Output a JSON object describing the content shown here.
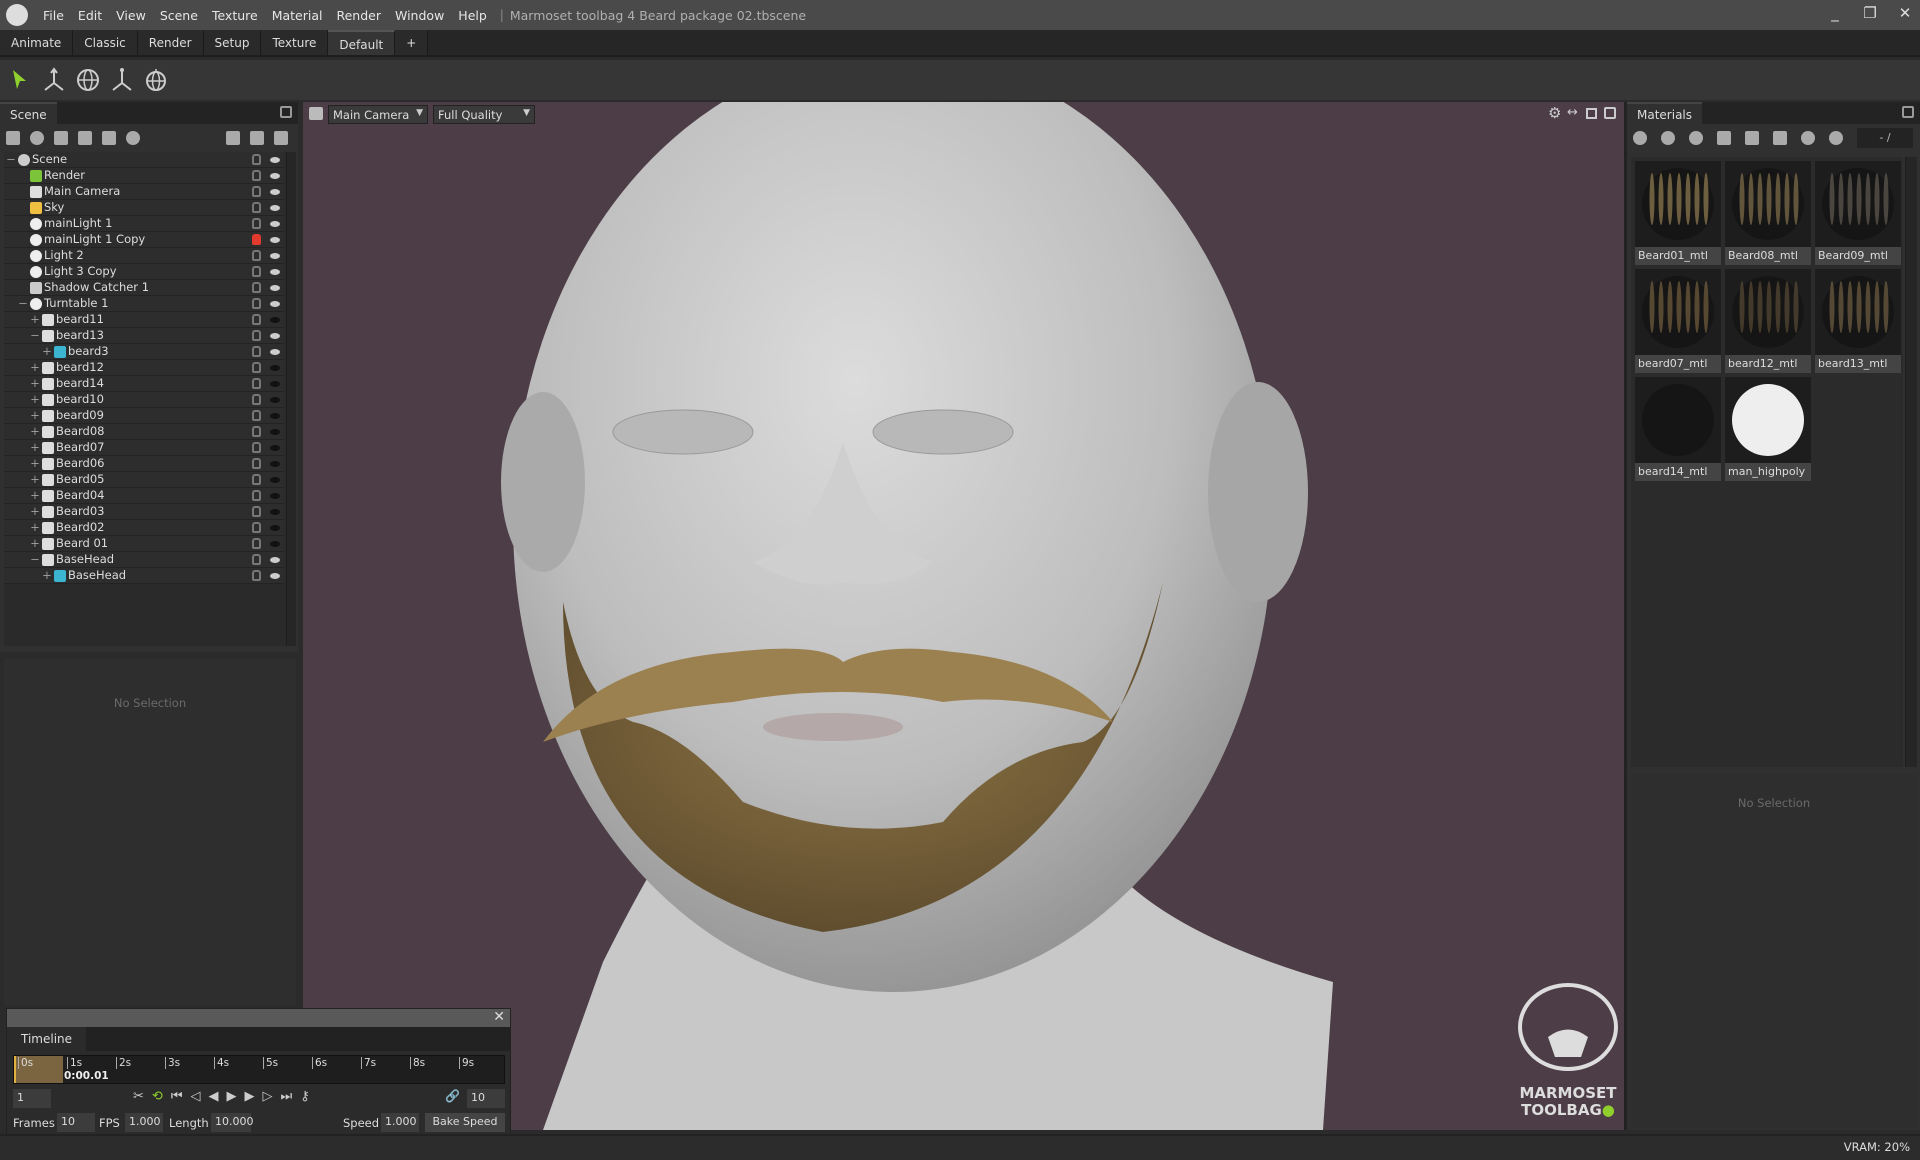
{
  "titlebar": {
    "menus": [
      "File",
      "Edit",
      "View",
      "Scene",
      "Texture",
      "Material",
      "Render",
      "Window",
      "Help"
    ],
    "title": "Marmoset toolbag 4 Beard package 02.tbscene"
  },
  "layout_tabs": [
    "Animate",
    "Classic",
    "Render",
    "Setup",
    "Texture",
    "Default",
    "+"
  ],
  "active_layout": "Default",
  "tools": [
    "select-arrow-icon",
    "move-gizmo-icon",
    "rotate-gizmo-icon",
    "scale-gizmo-icon",
    "turntable-gizmo-icon"
  ],
  "scene": {
    "tab": "Scene",
    "no_selection": "No Selection",
    "tree": [
      {
        "label": "Scene",
        "level": 0,
        "exp": "−",
        "icon": "scene",
        "eye": "open",
        "lock": "off"
      },
      {
        "label": "Render",
        "level": 1,
        "exp": "",
        "icon": "render",
        "eye": "open",
        "lock": "off"
      },
      {
        "label": "Main Camera",
        "level": 1,
        "exp": "",
        "icon": "camera",
        "eye": "open",
        "lock": "off"
      },
      {
        "label": "Sky",
        "level": 1,
        "exp": "",
        "icon": "sky",
        "eye": "open",
        "lock": "off"
      },
      {
        "label": "mainLight 1",
        "level": 1,
        "exp": "",
        "icon": "light",
        "eye": "open",
        "lock": "off"
      },
      {
        "label": "mainLight 1 Copy",
        "level": 1,
        "exp": "",
        "icon": "light",
        "eye": "open",
        "lock": "on"
      },
      {
        "label": "Light 2",
        "level": 1,
        "exp": "",
        "icon": "light",
        "eye": "open",
        "lock": "off"
      },
      {
        "label": "Light 3 Copy",
        "level": 1,
        "exp": "",
        "icon": "light",
        "eye": "open",
        "lock": "off"
      },
      {
        "label": "Shadow Catcher 1",
        "level": 1,
        "exp": "",
        "icon": "shadow",
        "eye": "open",
        "lock": "off"
      },
      {
        "label": "Turntable 1",
        "level": 1,
        "exp": "−",
        "icon": "turntable",
        "eye": "open",
        "lock": "off"
      },
      {
        "label": "beard11",
        "level": 2,
        "exp": "+",
        "icon": "group",
        "eye": "dark",
        "lock": "off"
      },
      {
        "label": "beard13",
        "level": 2,
        "exp": "−",
        "icon": "group",
        "eye": "open",
        "lock": "off"
      },
      {
        "label": "beard3",
        "level": 3,
        "exp": "+",
        "icon": "mesh",
        "eye": "open",
        "lock": "off"
      },
      {
        "label": "beard12",
        "level": 2,
        "exp": "+",
        "icon": "group",
        "eye": "dark",
        "lock": "off"
      },
      {
        "label": "beard14",
        "level": 2,
        "exp": "+",
        "icon": "group",
        "eye": "dark",
        "lock": "off"
      },
      {
        "label": "beard10",
        "level": 2,
        "exp": "+",
        "icon": "group",
        "eye": "dark",
        "lock": "off"
      },
      {
        "label": "beard09",
        "level": 2,
        "exp": "+",
        "icon": "group",
        "eye": "dark",
        "lock": "off"
      },
      {
        "label": "Beard08",
        "level": 2,
        "exp": "+",
        "icon": "group",
        "eye": "dark",
        "lock": "off"
      },
      {
        "label": "Beard07",
        "level": 2,
        "exp": "+",
        "icon": "group",
        "eye": "dark",
        "lock": "off"
      },
      {
        "label": "Beard06",
        "level": 2,
        "exp": "+",
        "icon": "group",
        "eye": "dark",
        "lock": "off"
      },
      {
        "label": "Beard05",
        "level": 2,
        "exp": "+",
        "icon": "group",
        "eye": "dark",
        "lock": "off"
      },
      {
        "label": "Beard04",
        "level": 2,
        "exp": "+",
        "icon": "group",
        "eye": "dark",
        "lock": "off"
      },
      {
        "label": "Beard03",
        "level": 2,
        "exp": "+",
        "icon": "group",
        "eye": "dark",
        "lock": "off"
      },
      {
        "label": "Beard02",
        "level": 2,
        "exp": "+",
        "icon": "group",
        "eye": "dark",
        "lock": "off"
      },
      {
        "label": "Beard 01",
        "level": 2,
        "exp": "+",
        "icon": "group",
        "eye": "dark",
        "lock": "off"
      },
      {
        "label": "BaseHead",
        "level": 2,
        "exp": "−",
        "icon": "group",
        "eye": "open",
        "lock": "off"
      },
      {
        "label": "BaseHead",
        "level": 3,
        "exp": "+",
        "icon": "mesh",
        "eye": "open",
        "lock": "off"
      }
    ]
  },
  "viewport": {
    "camera": "Main Camera",
    "quality": "Full Quality",
    "logo_text": [
      "MARMOSET",
      "TOOLBAG"
    ],
    "background": "#4d3d46"
  },
  "materials": {
    "tab": "Materials",
    "counter": "- /",
    "no_selection": "No Selection",
    "items": [
      {
        "name": "Beard01_mtl",
        "type": "hair",
        "tint": "#b59a60"
      },
      {
        "name": "Beard08_mtl",
        "type": "hair",
        "tint": "#a08a5c"
      },
      {
        "name": "Beard09_mtl",
        "type": "hair",
        "tint": "#777062"
      },
      {
        "name": "beard07_mtl",
        "type": "hair",
        "tint": "#8c7248"
      },
      {
        "name": "beard12_mtl",
        "type": "hair",
        "tint": "#6b5a3e"
      },
      {
        "name": "beard13_mtl",
        "type": "hair",
        "tint": "#8a7450"
      },
      {
        "name": "beard14_mtl",
        "type": "dark",
        "tint": "#222222"
      },
      {
        "name": "man_highpoly",
        "type": "solid",
        "tint": "#eeeeee"
      }
    ]
  },
  "timeline": {
    "tab": "Timeline",
    "ticks": [
      "0s",
      "1s",
      "2s",
      "3s",
      "4s",
      "5s",
      "6s",
      "7s",
      "8s",
      "9s"
    ],
    "current_time": "0:00.01",
    "frame": "1",
    "end_frame": "10",
    "frames_label": "Frames",
    "frames": "10",
    "fps_label": "FPS",
    "fps": "1.000",
    "length_label": "Length",
    "length": "10.000",
    "speed_label": "Speed",
    "speed": "1.000",
    "bake_speed": "Bake Speed",
    "progress": 0.1
  },
  "status": {
    "vram": "VRAM: 20%"
  },
  "colors": {
    "accent_green": "#8fd02c",
    "lock_red": "#e23b2e",
    "timeline_fill": "#7a6540"
  }
}
